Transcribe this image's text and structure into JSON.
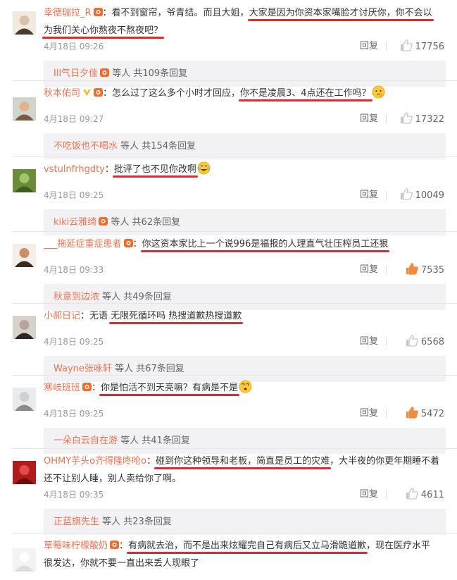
{
  "comments": [
    {
      "user": "幸德瑞拉_R",
      "badge": true,
      "segments": [
        {
          "text": "：看不到窗帘，爷青结。而且大姐，",
          "hl": false
        },
        {
          "text": "大家是因为你资本家嘴脸才讨厌你，你不会以",
          "hl": true
        }
      ],
      "segments2": [
        {
          "text": "为我们关心你熬夜不熬夜吧？",
          "hl": true
        }
      ],
      "time": "4月18日 09:26",
      "reply": "回复",
      "likes": "17756",
      "sub": {
        "names": "Ill气日夕佳",
        "badge": true,
        "suffix": "等人 共109条回复"
      }
    },
    {
      "user": "秋本佑司",
      "vip": true,
      "badge": true,
      "segments": [
        {
          "text": "：怎么过了这么多个小时才回应，",
          "hl": false
        },
        {
          "text": "你不是凌晨3、4点还在工作吗？",
          "hl": true
        }
      ],
      "emoji": "thinking",
      "time": "4月18日 09:27",
      "reply": "回复",
      "likes": "17322",
      "sub": {
        "names": "不吃饭也不喝水",
        "badge": false,
        "suffix": "等人 共154条回复"
      }
    },
    {
      "user": "vstulnfrhgdty",
      "badge": false,
      "segments": [
        {
          "text": "：",
          "hl": false
        },
        {
          "text": "批评了也不见你改啊",
          "hl": true
        }
      ],
      "emoji": "laugh2",
      "time": "4月18日 09:25",
      "reply": "回复",
      "likes": "10049",
      "sub": {
        "names": "kiki云雅绮",
        "badge": true,
        "suffix": "等人 共62条回复"
      }
    },
    {
      "user": "___拖延症重症患者",
      "badge": true,
      "segments": [
        {
          "text": "：",
          "hl": false
        },
        {
          "text": "你这资本家比上一个说996是福报的人理直气壮压榨员工还狠",
          "hl": true
        }
      ],
      "time": "4月18日 09:33",
      "reply": "回复",
      "likes": "7535",
      "likeActive": true,
      "sub": {
        "names": "秋意到边浓",
        "badge": false,
        "suffix": "等人 共49条回复"
      }
    },
    {
      "user": "小郝日记",
      "badge": false,
      "segments": [
        {
          "text": "：无语 ",
          "hl": false
        },
        {
          "text": "无限死循环吗 热搜道歉热搜道歉",
          "hl": true
        }
      ],
      "time": "4月18日 09:25",
      "reply": "回复",
      "likes": "6568",
      "sub": {
        "names": "Wayne张咏轩",
        "badge": false,
        "suffix": "等人 共67条回复"
      }
    },
    {
      "user": "寒岐班班",
      "badge": true,
      "segments": [
        {
          "text": "：",
          "hl": false
        },
        {
          "text": "你是怕活不到天亮嘛？有病是不是",
          "hl": true
        }
      ],
      "emoji": "dizzy",
      "time": "4月18日 09:25",
      "reply": "回复",
      "likes": "5472",
      "likeActive": true,
      "sub": {
        "names": "一朵白云自在游",
        "badge": false,
        "suffix": "等人 共41条回复"
      }
    },
    {
      "user": "OHMY芋头o齐得隆咚呛o",
      "badge": false,
      "segments": [
        {
          "text": "：",
          "hl": false
        },
        {
          "text": "碰到你这种领导和老板，简直是员工的灾难",
          "hl": true
        },
        {
          "text": "，大半夜的你更年期睡不着",
          "hl": false
        }
      ],
      "segments2": [
        {
          "text": "还不让别人睡，别人卖给你了啊。",
          "hl": false
        }
      ],
      "time": "4月18日 09:35",
      "reply": "回复",
      "likes": "4611",
      "sub": {
        "names": "正蓝旗先生",
        "badge": false,
        "suffix": "等人 共23条回复"
      }
    },
    {
      "user": "草莓味柠檬酸奶",
      "badge": true,
      "segments": [
        {
          "text": "：",
          "hl": false
        },
        {
          "text": "有病就去治，而不是出来炫耀完自己有病后又立马滑跪道歉",
          "hl": true
        },
        {
          "text": "，现在医疗水平",
          "hl": false
        }
      ],
      "segments2": [
        {
          "text": "很发达，你就不要一直出来丢人现眼了",
          "hl": false
        }
      ]
    }
  ],
  "colors": {
    "username": "#eb7350",
    "highlight": "#e8262e",
    "subbox": "#f2f2f5",
    "meta": "#999999"
  }
}
